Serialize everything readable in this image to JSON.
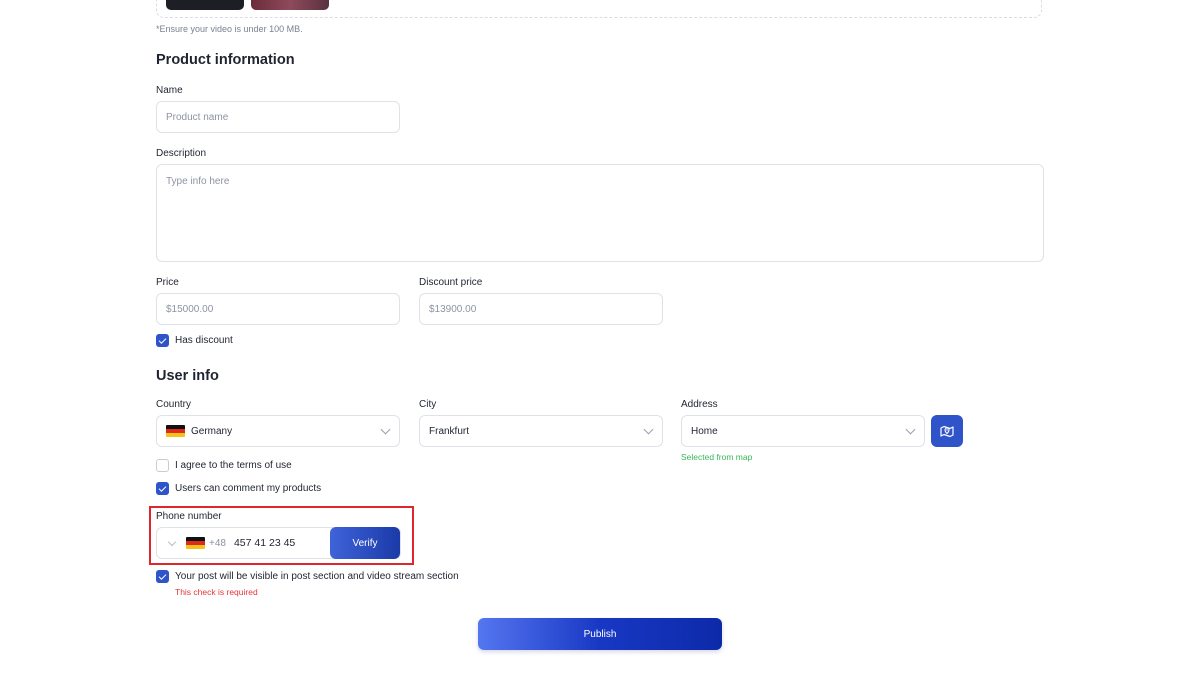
{
  "media": {
    "hint": "*Ensure your video is under 100 MB."
  },
  "product": {
    "title": "Product information",
    "name_label": "Name",
    "name_placeholder": "Product name",
    "description_label": "Description",
    "description_placeholder": "Type info here",
    "price_label": "Price",
    "price_value": "$15000.00",
    "discount_label": "Discount price",
    "discount_value": "$13900.00",
    "has_discount_label": "Has discount",
    "has_discount_checked": true
  },
  "user": {
    "title": "User info",
    "country_label": "Country",
    "country_value": "Germany",
    "city_label": "City",
    "city_value": "Frankfurt",
    "address_label": "Address",
    "address_value": "Home",
    "address_hint": "Selected from map",
    "terms_label": "I agree to the terms of use",
    "terms_checked": false,
    "comments_label": "Users can comment my products",
    "comments_checked": true,
    "phone_label": "Phone number",
    "phone_code": "+48",
    "phone_value": "457 41 23 45",
    "verify_label": "Verify",
    "visibility_label": "Your post will be visible in post section and video stream section",
    "visibility_checked": true,
    "visibility_error": "This check is required"
  },
  "actions": {
    "publish_label": "Publish"
  },
  "colors": {
    "accent": "#2f53c9",
    "error": "#e5353b",
    "success": "#3bb55d",
    "highlight": "#e0262d"
  },
  "icons": {
    "flag": "germany-flag-icon",
    "map": "map-pin-icon",
    "check": "checkmark-icon",
    "chevron": "chevron-down-icon"
  }
}
